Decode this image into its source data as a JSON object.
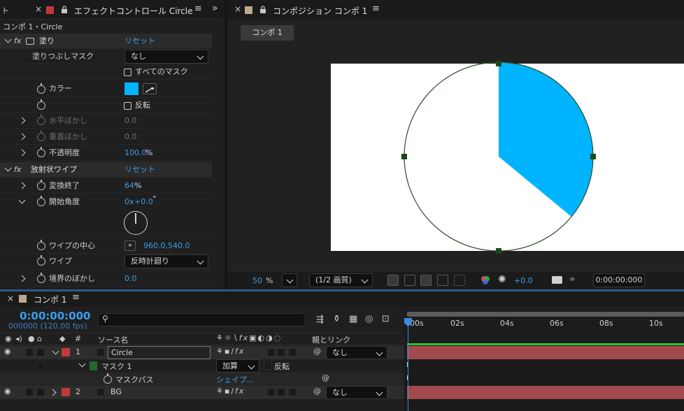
{
  "effects_panel": {
    "tab_left": "ト",
    "tab_title": "エフェクトコントロール Circle",
    "layer_path": "コンポ 1・Circle",
    "fill_effect": {
      "name": "塗り",
      "reset": "リセット",
      "fill_mask_label": "塗りつぶしマスク",
      "fill_mask_value": "なし",
      "all_masks_label": "すべてのマスク",
      "color_label": "カラー",
      "color": "#00b4ff",
      "invert_label": "反転",
      "h_feather_label": "水平ぼかし",
      "h_feather_value": "0.0",
      "v_feather_label": "垂直ぼかし",
      "v_feather_value": "0.0",
      "opacity_label": "不透明度",
      "opacity_value": "100.0",
      "opacity_unit": "%"
    },
    "radial_wipe": {
      "name": "放射状ワイプ",
      "reset": "リセット",
      "completion_label": "変換終了",
      "completion_value": "64",
      "completion_unit": "%",
      "start_angle_label": "開始角度",
      "start_angle_rev": "0x",
      "start_angle_deg": "+0.0",
      "start_angle_unit": "°",
      "center_label": "ワイプの中心",
      "center_value": "960.0,540.0",
      "wipe_label": "ワイプ",
      "wipe_value": "反時計廻り",
      "feather_label": "境界のぼかし",
      "feather_value": "0.0"
    }
  },
  "comp_panel": {
    "tab_title": "コンポジション コンポ 1",
    "comp_button": "コンポ 1",
    "fill_color": "#00b4ff",
    "wipe_completion": 0.64,
    "zoom_value": "50",
    "zoom_unit": "%",
    "resolution": "(1/2 画質)",
    "exposure": "+0.0",
    "timecode": "0:00:00:000"
  },
  "timeline": {
    "tab_title": "コンポ 1",
    "current_time": "0:00:00:000",
    "frame_info": "000000 (120.00 fps)",
    "search_placeholder": "",
    "col_number": "#",
    "col_source": "ソース名",
    "col_parent": "親とリンク",
    "ruler": [
      "00s",
      "02s",
      "04s",
      "06s",
      "08s",
      "10s"
    ],
    "layers": [
      {
        "num": "1",
        "name": "Circle",
        "label_color": "#c0393f",
        "parent": "なし"
      },
      {
        "num": "2",
        "name": "BG",
        "label_color": "#c0393f",
        "parent": "なし"
      }
    ],
    "mask_name": "マスク 1",
    "mask_mode": "加算",
    "mask_invert": "反転",
    "mask_path_label": "マスクパス",
    "mask_path_value": "シェイプ..."
  }
}
